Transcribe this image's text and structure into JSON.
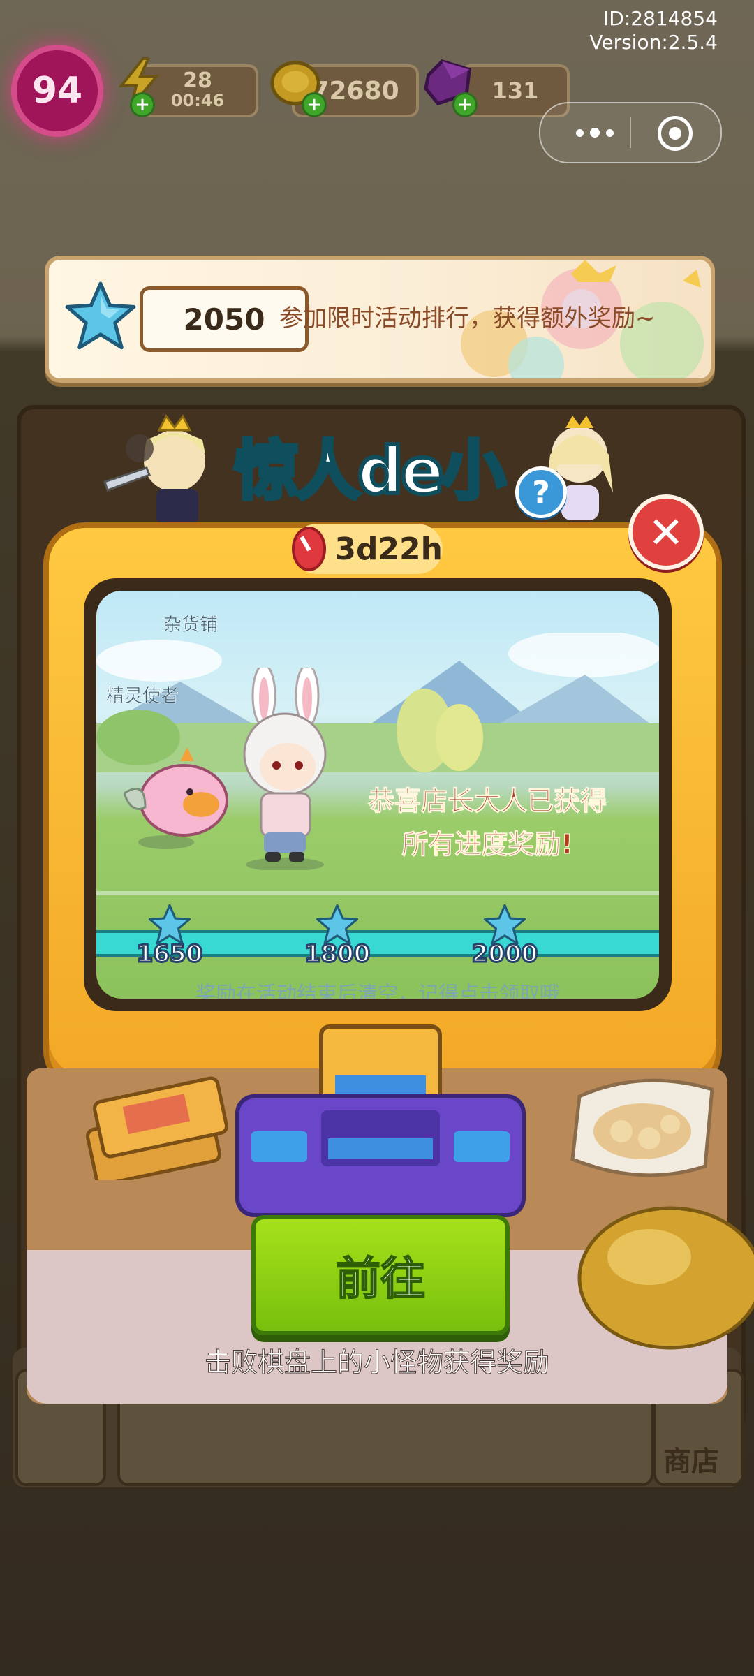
{
  "device": {
    "id_text": "ID:2814854",
    "version_text": "Version:2.5.4"
  },
  "hud": {
    "level": "94",
    "energy": {
      "value": "28",
      "timer": "00:46"
    },
    "coins": "72680",
    "gems": "131"
  },
  "banner": {
    "score": "2050",
    "text": "参加限时活动排行，获得额外奖励~"
  },
  "event": {
    "title": "惊人de小怪物",
    "countdown": "3d22h",
    "npc_shop": "杂货铺",
    "npc_spirit": "精灵使者",
    "congrats_line1": "恭喜店长大人已获得",
    "congrats_line2": "所有进度奖励!",
    "milestones": [
      {
        "value": "1650"
      },
      {
        "value": "1800"
      },
      {
        "value": "2000"
      }
    ],
    "note": "奖励在活动结束后清空，记得点击领取哦",
    "go_button": "前往",
    "bottom_text": "击败棋盘上的小怪物获得奖励"
  },
  "background": {
    "shop_label": "商店"
  },
  "colors": {
    "accent_green": "#78c00e",
    "tv_yellow": "#ffc941",
    "close_red": "#e0413e",
    "progress_cyan": "#38d9d2"
  },
  "icons": [
    "lightning-icon",
    "coin-icon",
    "gem-icon",
    "star-icon",
    "clock-icon",
    "close-icon",
    "help-icon",
    "more-dots-icon",
    "exit-target-icon"
  ]
}
